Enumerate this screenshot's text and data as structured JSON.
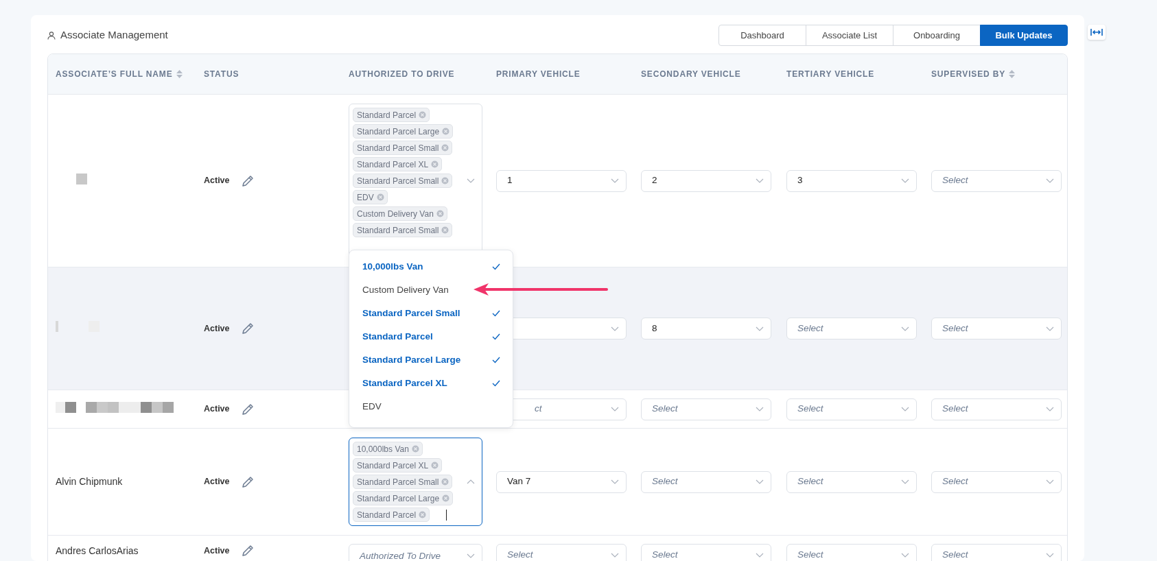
{
  "title": "Associate Management",
  "tabs": [
    {
      "label": "Dashboard",
      "selected": false
    },
    {
      "label": "Associate List",
      "selected": false
    },
    {
      "label": "Onboarding",
      "selected": false
    },
    {
      "label": "Bulk Updates",
      "selected": true
    }
  ],
  "columns": [
    {
      "label": "ASSOCIATE’S FULL NAME",
      "sortable": true
    },
    {
      "label": "STATUS",
      "sortable": false
    },
    {
      "label": "AUTHORIZED TO DRIVE",
      "sortable": false
    },
    {
      "label": "PRIMARY VEHICLE",
      "sortable": false
    },
    {
      "label": "SECONDARY VEHICLE",
      "sortable": false
    },
    {
      "label": "TERTIARY VEHICLE",
      "sortable": false
    },
    {
      "label": "SUPERVISED BY",
      "sortable": true
    }
  ],
  "rows": [
    {
      "kind": "redacted",
      "highlighted": false,
      "status": "Active",
      "authorized": {
        "tags": [
          "Standard Parcel",
          "Standard Parcel Large",
          "Standard Parcel Small",
          "Standard Parcel XL",
          "Standard Parcel Small",
          "EDV",
          "Custom Delivery Van",
          "Standard Parcel Small"
        ],
        "open": false,
        "focused": false
      },
      "vehicles": [
        {
          "value": "1"
        },
        {
          "value": "2"
        },
        {
          "value": "3"
        },
        {
          "placeholder": "Select"
        }
      ]
    },
    {
      "kind": "redacted",
      "highlighted": true,
      "status": "Active",
      "vehicles": [
        {
          "kind": "empty"
        },
        {
          "value": "8"
        },
        {
          "placeholder": "Select"
        },
        {
          "placeholder": "Select"
        }
      ]
    },
    {
      "kind": "redacted",
      "highlighted": false,
      "status": "Active",
      "vehicles": [
        {
          "placeholder": "ct"
        },
        {
          "placeholder": "Select"
        },
        {
          "placeholder": "Select"
        },
        {
          "placeholder": "Select"
        }
      ]
    },
    {
      "kind": "named",
      "name": "Alvin Chipmunk",
      "highlighted": false,
      "status": "Active",
      "authorized": {
        "tags": [
          "10,000lbs Van",
          "Standard Parcel XL",
          "Standard Parcel Small",
          "Standard Parcel Large",
          "Standard Parcel"
        ],
        "open": true,
        "focused": true,
        "options": [
          {
            "label": "10,000lbs Van",
            "selected": true,
            "pointed": false
          },
          {
            "label": "Custom Delivery Van",
            "selected": false,
            "pointed": true
          },
          {
            "label": "Standard Parcel Small",
            "selected": true,
            "pointed": false
          },
          {
            "label": "Standard Parcel",
            "selected": true,
            "pointed": false
          },
          {
            "label": "Standard Parcel Large",
            "selected": true,
            "pointed": false
          },
          {
            "label": "Standard Parcel XL",
            "selected": true,
            "pointed": false
          },
          {
            "label": "EDV",
            "selected": false,
            "pointed": false
          }
        ]
      },
      "vehicles": [
        {
          "value": "Van 7"
        },
        {
          "placeholder": "Select"
        },
        {
          "placeholder": "Select"
        },
        {
          "placeholder": "Select"
        }
      ]
    },
    {
      "kind": "named",
      "name": "Andres CarlosArias",
      "highlighted": false,
      "status": "Active",
      "authorized": {
        "placeholder": "Authorized To Drive",
        "open": false,
        "focused": false
      },
      "vehicles": [
        {
          "placeholder": "Select"
        },
        {
          "placeholder": "Select"
        },
        {
          "placeholder": "Select"
        },
        {
          "placeholder": "Select"
        }
      ]
    }
  ]
}
